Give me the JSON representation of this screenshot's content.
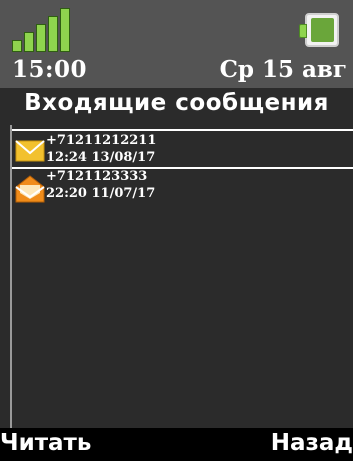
{
  "status": {
    "time": "15:00",
    "date": "Ср 15 авг",
    "signal_icon": "signal-bars-icon",
    "battery_icon": "battery-icon"
  },
  "header": {
    "title": "Входящие сообщения"
  },
  "messages": [
    {
      "sender": "+71211212211",
      "timestamp": "12:24 13/08/17",
      "icon": "envelope-closed-icon",
      "selected": true
    },
    {
      "sender": "+7121123333",
      "timestamp": "22:20 11/07/17",
      "icon": "envelope-open-icon",
      "selected": false
    }
  ],
  "softkeys": {
    "left": "Читать",
    "right": "Назад"
  },
  "colors": {
    "signal": "#8fd44e",
    "battery": "#6aa63a",
    "envelope_closed": "#f2c12e",
    "envelope_open": "#f08c1a"
  }
}
